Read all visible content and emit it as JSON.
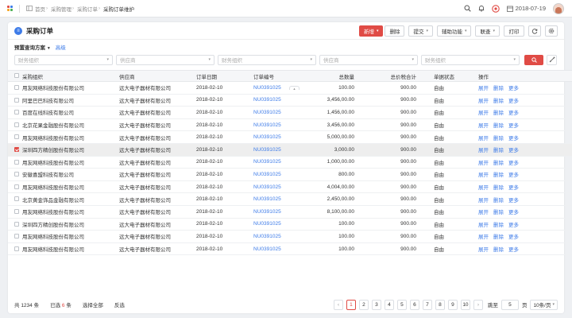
{
  "topbar": {
    "breadcrumb": [
      "首页",
      "采购管理",
      "采购订单",
      "采购订单维护"
    ],
    "date": "2018-07-19"
  },
  "page": {
    "title": "采购订单"
  },
  "toolbar": {
    "new_label": "新增",
    "delete_label": "删除",
    "submit_label": "提交",
    "assist_label": "辅助功能",
    "linked_label": "联查",
    "print_label": "打印"
  },
  "filters": {
    "preset_label": "预置查询方案",
    "advanced_label": "高级",
    "fields": [
      {
        "placeholder": "财务组织"
      },
      {
        "placeholder": "供应商"
      },
      {
        "placeholder": "财务组织"
      },
      {
        "placeholder": "供应商"
      },
      {
        "placeholder": "财务组织"
      }
    ]
  },
  "table": {
    "columns": [
      "采购组织",
      "供应商",
      "订单日期",
      "订单编号",
      "总数量",
      "总价税合计",
      "单据状态",
      "操作"
    ],
    "actions": [
      "展开",
      "删除",
      "更多"
    ],
    "rows": [
      {
        "org": "用友网络科技股份有限公司",
        "supplier": "远大电子器材有限公司",
        "date": "2018-02-10",
        "code": "NU0391025",
        "qty": "100.00",
        "total": "900.00",
        "status": "自由",
        "checked": false
      },
      {
        "org": "阿里巴巴科技有限公司",
        "supplier": "远大电子器材有限公司",
        "date": "2018-02-10",
        "code": "NU0391025",
        "qty": "3,456,00.00",
        "total": "900.00",
        "status": "自由",
        "checked": false
      },
      {
        "org": "百度在线科技有限公司",
        "supplier": "远大电子器材有限公司",
        "date": "2018-02-10",
        "code": "NU0391025",
        "qty": "1,456,00.00",
        "total": "900.00",
        "status": "自由",
        "checked": false
      },
      {
        "org": "北京花果金融股份有限公司",
        "supplier": "远大电子器材有限公司",
        "date": "2018-02-10",
        "code": "NU0391025",
        "qty": "3,456,00.00",
        "total": "900.00",
        "status": "自由",
        "checked": false
      },
      {
        "org": "用友网络科技股份有限公司",
        "supplier": "远大电子器材有限公司",
        "date": "2018-02-10",
        "code": "NU0391025",
        "qty": "5,000,00.00",
        "total": "900.00",
        "status": "自由",
        "checked": false
      },
      {
        "org": "深圳四方精创股份有限公司",
        "supplier": "远大电子器材有限公司",
        "date": "2018-02-10",
        "code": "NU0391025",
        "qty": "3,000.00",
        "total": "900.00",
        "status": "自由",
        "checked": true
      },
      {
        "org": "用友网络科技股份有限公司",
        "supplier": "远大电子器材有限公司",
        "date": "2018-02-10",
        "code": "NU0391025",
        "qty": "1,000,00.00",
        "total": "900.00",
        "status": "自由",
        "checked": false
      },
      {
        "org": "安徽喜盟科技有限公司",
        "supplier": "远大电子器材有限公司",
        "date": "2018-02-10",
        "code": "NU0391025",
        "qty": "800.00",
        "total": "900.00",
        "status": "自由",
        "checked": false
      },
      {
        "org": "用友网络科技股份有限公司",
        "supplier": "远大电子器材有限公司",
        "date": "2018-02-10",
        "code": "NU0391025",
        "qty": "4,004,00.00",
        "total": "900.00",
        "status": "自由",
        "checked": false
      },
      {
        "org": "北京黄金饰品金融有限公司",
        "supplier": "远大电子器材有限公司",
        "date": "2018-02-10",
        "code": "NU0391025",
        "qty": "2,450,00.00",
        "total": "900.00",
        "status": "自由",
        "checked": false
      },
      {
        "org": "用友网络科技股份有限公司",
        "supplier": "远大电子器材有限公司",
        "date": "2018-02-10",
        "code": "NU0391025",
        "qty": "8,100,00.00",
        "total": "900.00",
        "status": "自由",
        "checked": false
      },
      {
        "org": "深圳四方精创股份有限公司",
        "supplier": "远大电子器材有限公司",
        "date": "2018-02-10",
        "code": "NU0391025",
        "qty": "100.00",
        "total": "900.00",
        "status": "自由",
        "checked": false
      },
      {
        "org": "用友网络科技股份有限公司",
        "supplier": "远大电子器材有限公司",
        "date": "2018-02-10",
        "code": "NU0391025",
        "qty": "100.00",
        "total": "900.00",
        "status": "自由",
        "checked": false
      },
      {
        "org": "用友网络科技股份有限公司",
        "supplier": "远大电子器材有限公司",
        "date": "2018-02-10",
        "code": "NU0391025",
        "qty": "100.00",
        "total": "900.00",
        "status": "自由",
        "checked": false
      }
    ]
  },
  "footer": {
    "total_prefix": "共",
    "total_count": "1234",
    "total_suffix": "条",
    "selected_prefix": "已选",
    "selected_count": "6",
    "selected_suffix": "条",
    "select_all_label": "选择全部",
    "invert_label": "反选",
    "pages": [
      "1",
      "2",
      "3",
      "4",
      "5",
      "6",
      "7",
      "8",
      "9",
      "10"
    ],
    "current_page": "1",
    "goto_label": "跳至",
    "goto_value": "5",
    "page_unit": "页",
    "page_size": "10条/页"
  },
  "colors": {
    "accent": "#e04b45",
    "link": "#3d7be8"
  }
}
